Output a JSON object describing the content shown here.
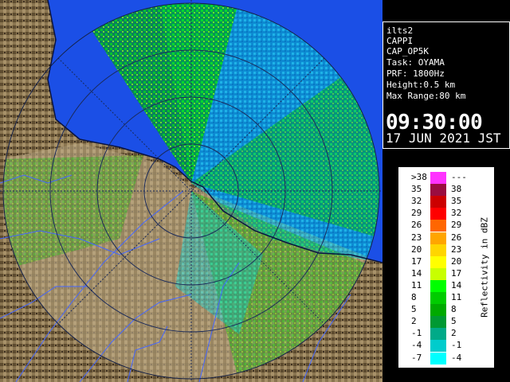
{
  "radar": {
    "site_name": "ilts2",
    "product": "CAPPI",
    "product_code": "CAP_OP5K",
    "task": "Task: OYAMA",
    "prf": "PRF: 1800Hz",
    "height": "Height:0.5 km",
    "max_range": "Max Range:80 km",
    "time": "09:30:00",
    "date": "17 JUN 2021 JST"
  },
  "legend": {
    "unit_label": "Reflectivity in dBZ",
    "entries": [
      {
        "low": ">38",
        "high": "---",
        "color": "#ff33ff"
      },
      {
        "low": "35",
        "high": "38",
        "color": "#9a0d40"
      },
      {
        "low": "32",
        "high": "35",
        "color": "#cc0000"
      },
      {
        "low": "29",
        "high": "32",
        "color": "#ff0000"
      },
      {
        "low": "26",
        "high": "29",
        "color": "#ff6600"
      },
      {
        "low": "23",
        "high": "26",
        "color": "#ffa500"
      },
      {
        "low": "20",
        "high": "23",
        "color": "#ffd500"
      },
      {
        "low": "17",
        "high": "20",
        "color": "#ffff00"
      },
      {
        "low": "14",
        "high": "17",
        "color": "#c8ff00"
      },
      {
        "low": "11",
        "high": "14",
        "color": "#00ff00"
      },
      {
        "low": "8",
        "high": "11",
        "color": "#00cc00"
      },
      {
        "low": "5",
        "high": "8",
        "color": "#00aa00"
      },
      {
        "low": "2",
        "high": "5",
        "color": "#009933"
      },
      {
        "low": "-1",
        "high": "2",
        "color": "#00aa88"
      },
      {
        "low": "-4",
        "high": "-1",
        "color": "#00cccc"
      },
      {
        "low": "-7",
        "high": "-4",
        "color": "#00ffff"
      }
    ]
  },
  "colors": {
    "sea": "#1b4fe6",
    "land_shade": "#6b5a3c",
    "land_light": "#b3a07a",
    "range_ring": "#1a2a5a",
    "coastline": "#0a1440",
    "river": "#4466ff"
  }
}
